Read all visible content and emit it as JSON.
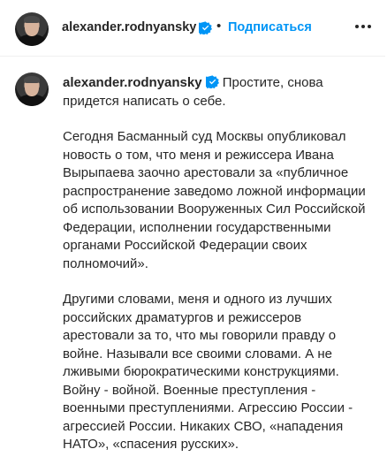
{
  "header": {
    "username": "alexander.rodnyansky",
    "separator": "•",
    "follow_label": "Подписаться",
    "icons": {
      "avatar": "profile-avatar",
      "verified": "verified-badge-icon",
      "more": "more-options-icon"
    }
  },
  "post": {
    "username": "alexander.rodnyansky",
    "caption_intro": "Простите, снова придется написать о себе.",
    "paragraph_1": "Сегодня Басманный суд Москвы опубликовал новость о том, что меня и режиссера Ивана Вырыпаева заочно арестовали за «публичное распространение заведомо ложной информации об использовании Вооруженных Сил Российской Федерации, исполнении государственными органами Российской Федерации своих полномочий».",
    "paragraph_2": "Другими словами, меня и одного из лучших российских драматургов и режиссеров арестовали за то, что мы говорили правду о войне. Называли все своими словами. А не лживыми бюрократическими конструкциями. Войну - войной. Военные преступления - военными преступлениями. Агрессию России - агрессией России. Никаких СВО, «нападения НАТО», «спасения русских»."
  },
  "colors": {
    "text": "#262626",
    "link_blue": "#0095f6",
    "verified_blue": "#0095f6",
    "divider": "#efefef"
  }
}
